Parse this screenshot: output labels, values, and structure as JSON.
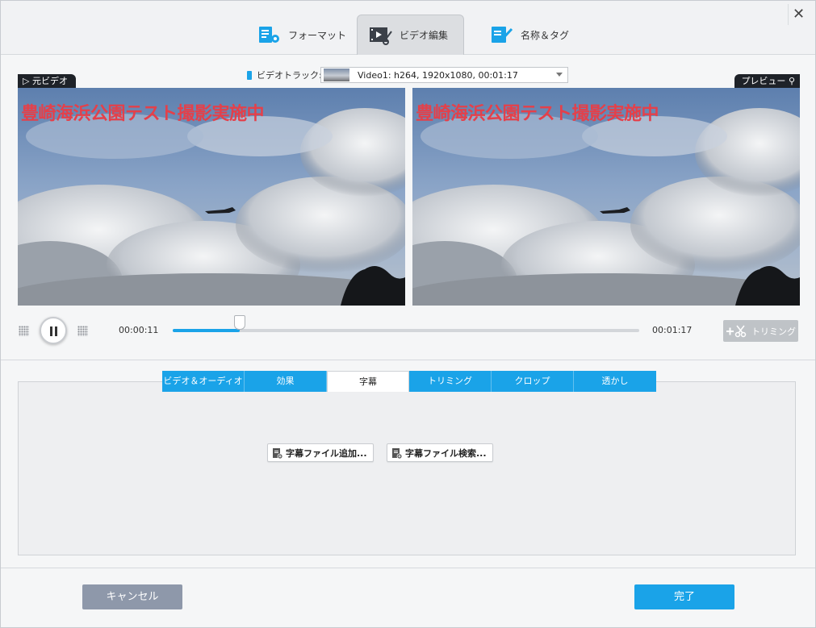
{
  "tabs": [
    {
      "label": "フォーマット",
      "icon": "format-settings-icon"
    },
    {
      "label": "ビデオ編集",
      "icon": "video-edit-icon",
      "active": true
    },
    {
      "label": "名称＆タグ",
      "icon": "name-tag-icon"
    }
  ],
  "source_label": "元ビデオ",
  "preview_label": "プレビュー",
  "video_track": {
    "label": "ビデオトラック:",
    "selected": "Video1: h264, 1920x1080, 00:01:17"
  },
  "overlay_text": "豊崎海浜公園テスト撮影実施中",
  "player": {
    "current_time": "00:00:11",
    "total_time": "00:01:17",
    "progress": 0.143,
    "trim_label": "トリミング"
  },
  "edit_tabs": [
    {
      "label": "ビデオ＆オーディオ"
    },
    {
      "label": "効果"
    },
    {
      "label": "字幕",
      "active": true
    },
    {
      "label": "トリミング"
    },
    {
      "label": "クロップ"
    },
    {
      "label": "透かし"
    }
  ],
  "subtitle_buttons": {
    "add_file": "字幕ファイル追加...",
    "search_file": "字幕ファイル検索..."
  },
  "footer": {
    "cancel": "キャンセル",
    "done": "完了"
  },
  "colors": {
    "accent": "#1aa3e8",
    "overlay_text": "#e4404a",
    "cancel": "#8e98aa"
  }
}
